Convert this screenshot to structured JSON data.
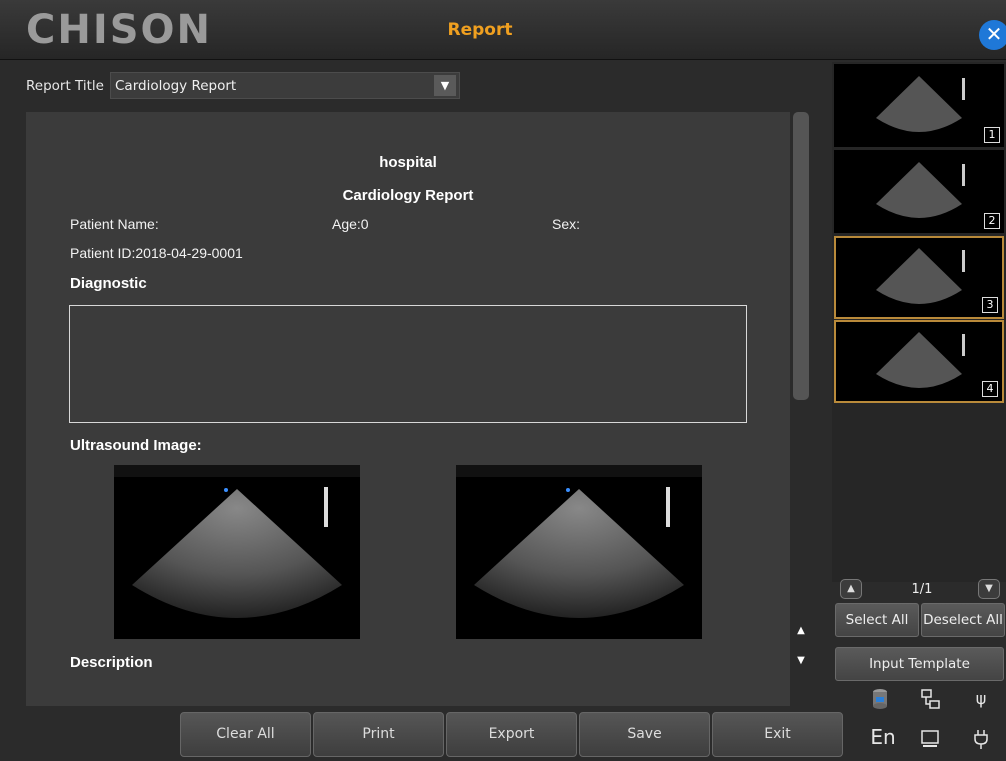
{
  "header": {
    "logo": "CHISON",
    "title": "Report",
    "close_icon": "close-icon"
  },
  "report_title": {
    "label": "Report Title",
    "value": "Cardiology Report",
    "dropdown_icon": "caret-down-icon"
  },
  "report": {
    "hospital": "hospital",
    "report_name": "Cardiology Report",
    "patient_name": "Patient Name:",
    "age": "Age:0",
    "sex": "Sex:",
    "patient_id": "Patient ID:2018-04-29-0001",
    "diagnostic_heading": "Diagnostic",
    "ultrasound_heading": "Ultrasound Image:",
    "description_heading": "Description"
  },
  "thumbnails": [
    {
      "number": "1",
      "selected": false
    },
    {
      "number": "2",
      "selected": false
    },
    {
      "number": "3",
      "selected": true
    },
    {
      "number": "4",
      "selected": true
    }
  ],
  "pager": {
    "text": "1/1"
  },
  "side_buttons": {
    "select_all": "Select All",
    "deselect_all": "Deselect All",
    "input_template": "Input Template"
  },
  "status": {
    "language": "En",
    "icons": [
      "database-icon",
      "network-icon",
      "usb-icon",
      "monitor-icon",
      "power-plug-icon"
    ]
  },
  "bottom_buttons": [
    "Clear All",
    "Print",
    "Export",
    "Save",
    "Exit"
  ],
  "colors": {
    "accent": "#f0a020",
    "close": "#1f78d8",
    "selected_border": "#b98a3a"
  }
}
